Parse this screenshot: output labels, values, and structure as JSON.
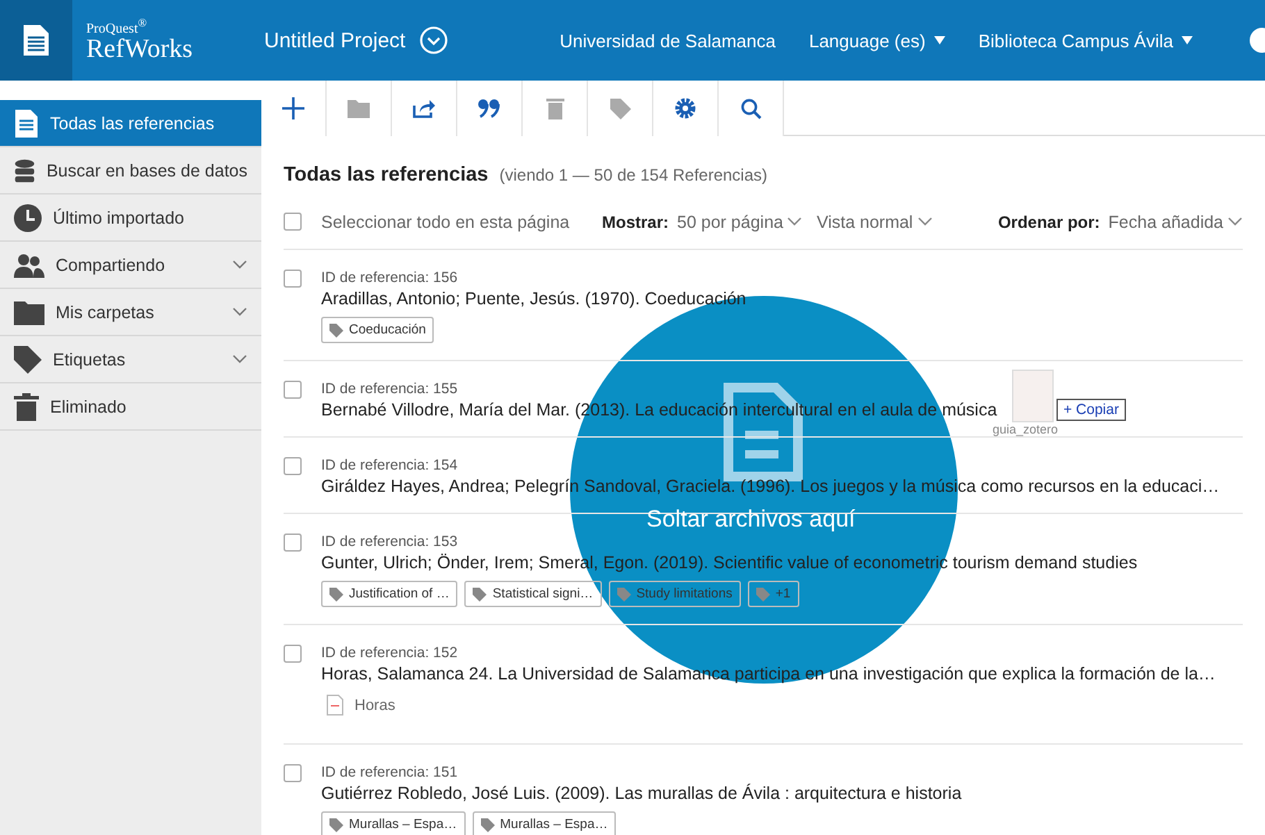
{
  "header": {
    "brand_small": "ProQuest",
    "brand_mark": "®",
    "brand": "RefWorks",
    "project": "Untitled Project",
    "links": [
      {
        "label": "Universidad de Salamanca",
        "dropdown": false
      },
      {
        "label": "Language (es)",
        "dropdown": true
      },
      {
        "label": "Biblioteca Campus Ávila",
        "dropdown": true
      }
    ]
  },
  "sidebar": {
    "items": [
      {
        "label": "Todas las referencias",
        "selected": true,
        "expandable": false
      },
      {
        "label": "Buscar en bases de datos",
        "selected": false,
        "expandable": false
      },
      {
        "label": "Último importado",
        "selected": false,
        "expandable": false
      },
      {
        "label": "Compartiendo",
        "selected": false,
        "expandable": true
      },
      {
        "label": "Mis carpetas",
        "selected": false,
        "expandable": true
      },
      {
        "label": "Etiquetas",
        "selected": false,
        "expandable": true
      },
      {
        "label": "Eliminado",
        "selected": false,
        "expandable": false
      }
    ]
  },
  "toolbar": [
    {
      "disabled": false
    },
    {
      "disabled": true
    },
    {
      "disabled": false
    },
    {
      "disabled": false
    },
    {
      "disabled": true
    },
    {
      "disabled": true
    },
    {
      "disabled": false
    },
    {
      "disabled": false
    }
  ],
  "list": {
    "title": "Todas las referencias",
    "count": "(viendo 1 — 50 de 154 Referencias)",
    "select_all": "Seleccionar todo en esta página",
    "select_all_checked": false,
    "show_label": "Mostrar:",
    "per_page": "50 por página",
    "view": "Vista normal",
    "sort_label": "Ordenar por:",
    "sort": "Fecha añadida",
    "references": [
      {
        "id": "ID de referencia: 156",
        "title": "Aradillas, Antonio; Puente, Jesús. (1970). Coeducación",
        "checked": false,
        "tags": [
          "Coeducación"
        ]
      },
      {
        "id": "ID de referencia: 155",
        "title": "Bernabé Villodre, María del Mar. (2013). La educación intercultural en el aula de música",
        "checked": false
      },
      {
        "id": "ID de referencia: 154",
        "title": "Giráldez Hayes, Andrea; Pelegrín Sandoval, Graciela. (1996). Los juegos y la música como recursos en la educaci…",
        "checked": false
      },
      {
        "id": "ID de referencia: 153",
        "title": "Gunter, Ulrich; Önder, Irem; Smeral, Egon. (2019). Scientific value of econometric tourism demand studies",
        "checked": false,
        "tags": [
          "Justification of …",
          "Statistical signi…",
          "Study limitations",
          "+1"
        ]
      },
      {
        "id": "ID de referencia: 152",
        "title": "Horas, Salamanca 24. La Universidad de Salamanca participa en una investigación que explica la formación de la…",
        "checked": false,
        "attachment": "Horas"
      },
      {
        "id": "ID de referencia: 151",
        "title": "Gutiérrez Robledo, José Luis. (2009). Las murallas de Ávila : arquitectura e historia",
        "checked": false,
        "tags": [
          "Murallas – Espa…",
          "Murallas – Espa…"
        ]
      }
    ]
  },
  "drop_overlay": {
    "label": "Soltar archivos aquí",
    "drag_file": "guia_zotero",
    "drag_action": "+ Copiar"
  }
}
